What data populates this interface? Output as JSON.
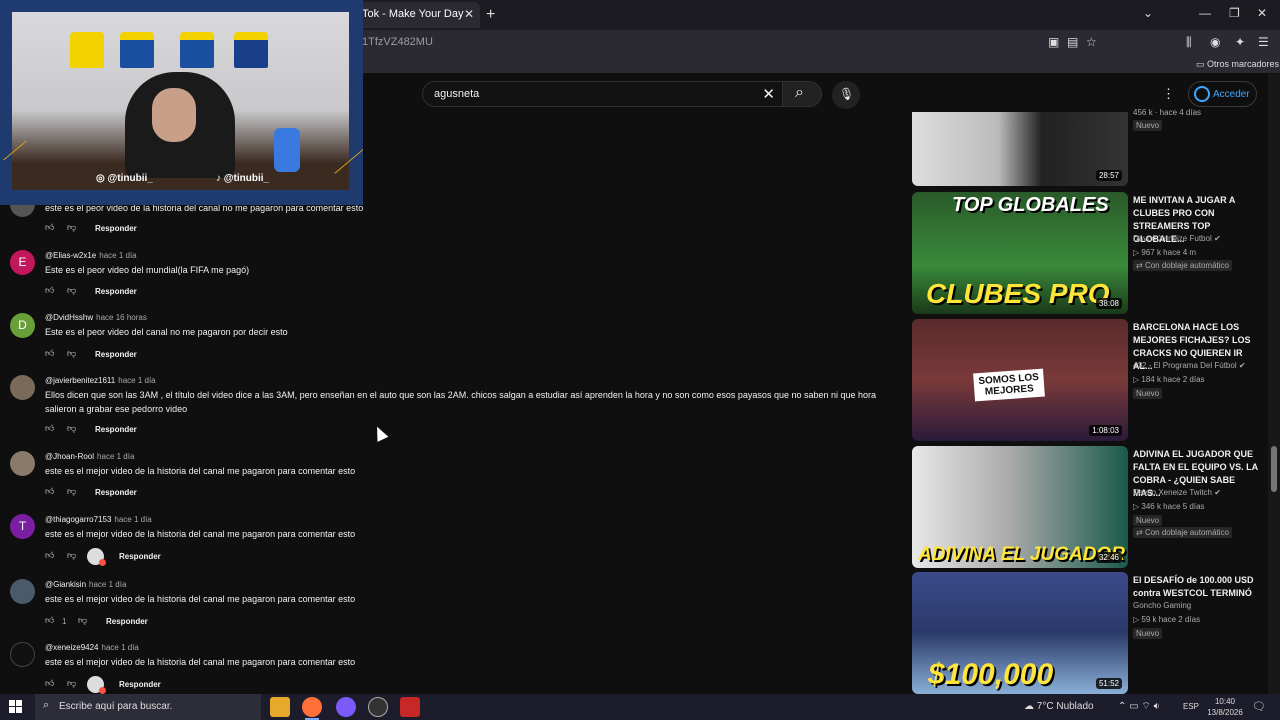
{
  "browser": {
    "tab_title": "Tok - Make Your Day",
    "tab_close": "✕",
    "new_tab": "+",
    "url_fragment": "1TfzVZ482MU",
    "bookmark_folder": "Otros marcadores",
    "window_controls": [
      "⌄",
      "—",
      "❐",
      "✕"
    ]
  },
  "youtube_header": {
    "search_value": "agusneta",
    "clear_glyph": "✕",
    "search_glyph": "⌕",
    "mic_glyph": "🎙",
    "more_glyph": "⋮",
    "signin_label": "Acceder"
  },
  "webcam": {
    "social_instagram": "@tinubii_",
    "social_tiktok": "@tinubii_"
  },
  "comments": [
    {
      "author": "",
      "time": "",
      "text": "este es el peor video de la historia del canal no me pagaron para comentar esto",
      "reply": "Responder"
    },
    {
      "author": "@Elias-w2x1e",
      "time": "hace 1 día",
      "text": "Este es el peor video del mundial(la FIFA me pagó)",
      "reply": "Responder",
      "avatar_letter": "E"
    },
    {
      "author": "@DvidHsshw",
      "time": "hace 16 horas",
      "text": "Este es el peor video del canal no me pagaron por decir esto",
      "reply": "Responder",
      "avatar_letter": "D"
    },
    {
      "author": "@javierbenitez1611",
      "time": "hace 1 día",
      "text": "Ellos dicen que son las 3AM , el título del video dice a las 3AM, pero enseñan en el auto que son las 2AM. chicos salgan a estudiar así aprenden la hora y no son como esos payasos que no saben ni que hora salieron a grabar ese pedorro video",
      "reply": "Responder"
    },
    {
      "author": "@Jhoan-Rool",
      "time": "hace 1 día",
      "text": "este es el mejor video de la historia del canal me pagaron para comentar esto",
      "reply": "Responder"
    },
    {
      "author": "@thiagogarro7153",
      "time": "hace 1 día",
      "text": "este es el mejor video de la historia del canal me pagaron para comentar esto",
      "reply": "Responder",
      "avatar_letter": "T"
    },
    {
      "author": "@Giankisin",
      "time": "hace 1 día",
      "text": "este es el mejor video de la historia del canal me pagaron para comentar esto",
      "reply": "Responder",
      "likes": "1"
    },
    {
      "author": "@xeneize9424",
      "time": "hace 1 día",
      "text": "este es el mejor video de la historia del canal me pagaron para comentar esto",
      "reply": "Responder"
    }
  ],
  "videos": [
    {
      "title": "",
      "channel": "",
      "meta": "",
      "badge": "Nuevo",
      "duration": "28:57",
      "top_meta": "456 k · hace 4 días"
    },
    {
      "title": "ME INVITAN A JUGAR A CLUBES PRO CON STREAMERS TOP GLOBALE...",
      "channel": "Davoo Xeneize Futbol",
      "meta": "967 k   hace 4 m",
      "dub": "Con doblaje automático",
      "duration": "38:08",
      "thumb_text": "CLUBES PRO",
      "thumb_top": "TOP GLOBALES"
    },
    {
      "title": "BARCELONA HACE LOS MEJORES FICHAJES? LOS CRACKS NO QUIEREN IR AL...",
      "channel": "412 - El Programa Del Fútbol",
      "meta": "184 k   hace 2 días",
      "badge": "Nuevo",
      "duration": "1:08:03",
      "thumb_text": "SOMOS LOS MEJORES"
    },
    {
      "title": "ADIVINA EL JUGADOR QUE FALTA EN EL EQUIPO VS. LA COBRA - ¿QUIEN SABE MAS...",
      "channel": "Davoo Xeneize Twitch",
      "meta": "346 k   hace 5 días",
      "badge": "Nuevo",
      "dub": "Con doblaje automático",
      "duration": "32:46",
      "thumb_text": "ADIVINA EL JUGADOR"
    },
    {
      "title": "El DESAFÍO de 100.000 USD contra WESTCOL TERMINÓ",
      "channel": "Goncho Gaming",
      "meta": "59 k   hace 2 días",
      "badge": "Nuevo",
      "duration": "51:52",
      "thumb_text": "$100,000"
    }
  ],
  "taskbar": {
    "search_placeholder": "Escribe aquí para buscar.",
    "weather": "7°C  Nublado",
    "lang": "ESP",
    "time": "10:40",
    "date": "13/8/2026"
  },
  "colors": {
    "background": "#0f0f0f",
    "accent_link": "#3ea6ff",
    "webcam_frame": "#1e3a6e",
    "gold": "#d4a017"
  }
}
